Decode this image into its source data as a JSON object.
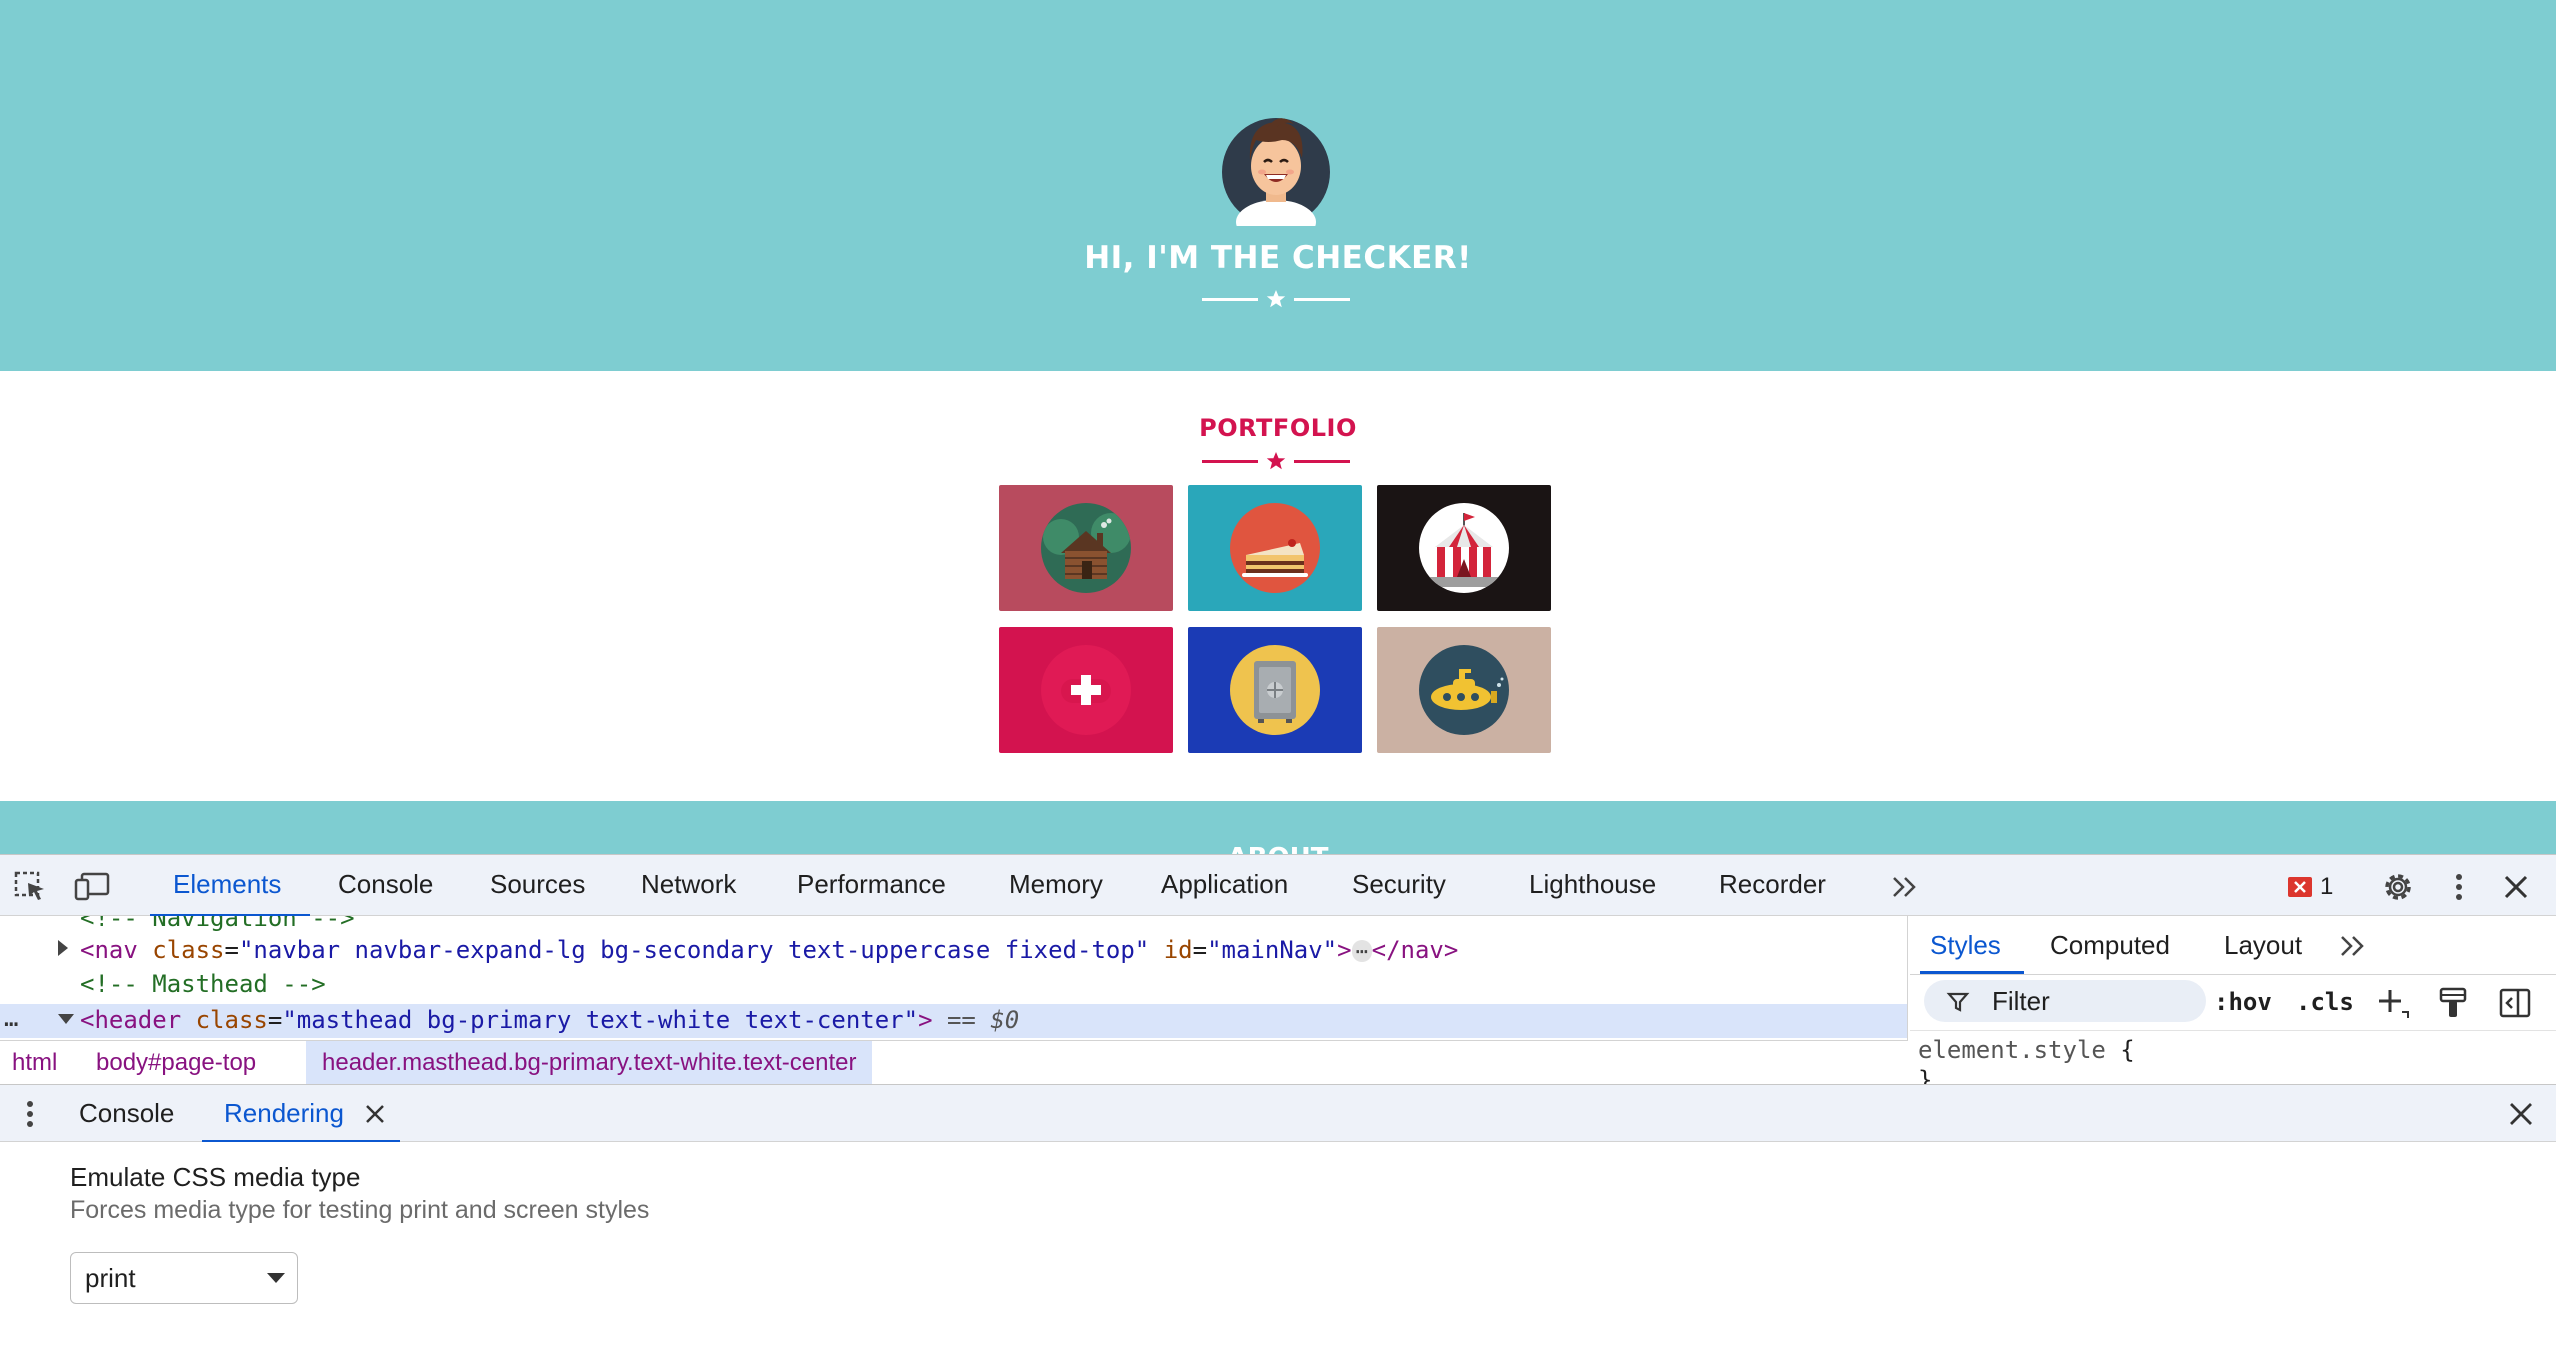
{
  "colors": {
    "primary": "#7ecdd1",
    "secondary": "#d3134f",
    "devtools_accent": "#0b57d0"
  },
  "masthead": {
    "title": "HI, I'M THE CHECKER!"
  },
  "portfolio": {
    "title": "PORTFOLIO",
    "items": [
      {
        "icon": "cabin-icon",
        "bg": "#b84b5e"
      },
      {
        "icon": "cake-icon",
        "bg": "#2aa7ba"
      },
      {
        "icon": "circus-tent-icon",
        "bg": "#1a1414"
      },
      {
        "icon": "game-controller-icon",
        "bg": "#d3134f"
      },
      {
        "icon": "safe-icon",
        "bg": "#1b3bb5"
      },
      {
        "icon": "submarine-icon",
        "bg": "#cbb1a3"
      }
    ]
  },
  "about": {
    "title": "ABOUT"
  },
  "devtools": {
    "tabs": [
      "Elements",
      "Console",
      "Sources",
      "Network",
      "Performance",
      "Memory",
      "Application",
      "Security",
      "Lighthouse",
      "Recorder"
    ],
    "active_tab": "Elements",
    "more_tabs_icon": "chevron-double-right-icon",
    "error_count": "1",
    "elements": {
      "line0": "<!-- Navigation -->",
      "line1": {
        "open": "<nav",
        "attr1": "class",
        "val1": "\"navbar navbar-expand-lg bg-secondary text-uppercase fixed-top\"",
        "attr2": "id",
        "val2": "\"mainNav\"",
        "gt": ">",
        "ellipsis": "⋯",
        "close": "</nav>"
      },
      "line2": "<!-- Masthead -->",
      "line3": {
        "dots": "…",
        "open": "<header",
        "attr1": "class",
        "val1": "\"masthead bg-primary text-white text-center\"",
        "gt": ">",
        "eq": "== $0"
      }
    },
    "breadcrumbs": [
      "html",
      "body#page-top",
      "header.masthead.bg-primary.text-white.text-center"
    ],
    "styles": {
      "tabs": [
        "Styles",
        "Computed",
        "Layout"
      ],
      "active_tab": "Styles",
      "filter_placeholder": "Filter",
      "hov": ":hov",
      "cls": ".cls",
      "rule_selector": "element.style",
      "open_brace": "{",
      "close_brace": "}"
    },
    "drawer": {
      "tabs": [
        "Console",
        "Rendering"
      ],
      "active_tab": "Rendering",
      "rendering": {
        "title": "Emulate CSS media type",
        "description": "Forces media type for testing print and screen styles",
        "select_value": "print"
      }
    }
  }
}
